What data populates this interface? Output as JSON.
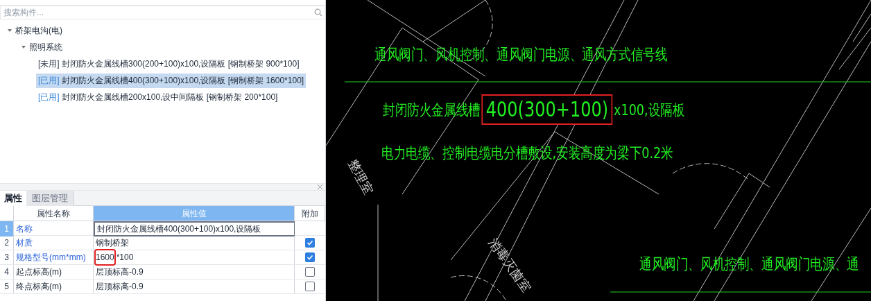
{
  "search": {
    "placeholder": "搜索构件..."
  },
  "tree": [
    {
      "label": "桥架电沟(电)",
      "expanded": true,
      "children": [
        {
          "label": "照明系统",
          "expanded": true,
          "children": [
            {
              "tag": "[未用]",
              "used": false,
              "label": "封闭防火金属线槽300(200+100)x100,设隔板 [钢制桥架 900*100]",
              "selected": false
            },
            {
              "tag": "[已用]",
              "used": true,
              "label": "封闭防火金属线槽400(300+100)x100,设隔板 [钢制桥架 1600*100]",
              "selected": true
            },
            {
              "tag": "[已用]",
              "used": true,
              "label": "封闭防火金属线槽200x100,设中间隔板 [钢制桥架 200*100]",
              "selected": false
            }
          ]
        }
      ]
    }
  ],
  "tabs": [
    {
      "label": "属性",
      "selected": true
    },
    {
      "label": "图层管理",
      "selected": false
    }
  ],
  "table": {
    "columns": [
      "属性名称",
      "属性值",
      "附加"
    ],
    "rows": [
      {
        "index": "1",
        "name": "名称",
        "linked": true,
        "value": [
          {
            "text": "封闭防火金属线槽400(300+100)x100,设隔板",
            "highlighted": false
          }
        ],
        "editing": true,
        "selected": true
      },
      {
        "index": "2",
        "name": "材质",
        "linked": true,
        "value": [
          {
            "text": "钢制桥架",
            "highlighted": false
          }
        ],
        "editing": false,
        "selected": false,
        "checked": true
      },
      {
        "index": "3",
        "name": "规格型号(mm*mm)",
        "linked": true,
        "value": [
          {
            "text": "1600",
            "highlighted": true
          },
          {
            "text": "*100",
            "highlighted": false
          }
        ],
        "editing": false,
        "selected": false,
        "checked": true
      },
      {
        "index": "4",
        "name": "起点标高(m)",
        "linked": false,
        "value": [
          {
            "text": "层顶标高-0.9",
            "highlighted": false
          }
        ],
        "editing": false,
        "selected": false,
        "checked": false
      },
      {
        "index": "5",
        "name": "终点标高(m)",
        "linked": false,
        "value": [
          {
            "text": "层顶标高-0.9",
            "highlighted": false
          }
        ],
        "editing": false,
        "selected": false,
        "checked": false
      }
    ]
  },
  "drawing": {
    "labels": [
      {
        "kind": "annotation",
        "parts": [
          {
            "text": "通风阀门、风机控制、通风阀门电源、通风方式信号线",
            "highlighted": false
          }
        ]
      },
      {
        "kind": "annotation",
        "parts": [
          {
            "text": "封闭防火金属线槽",
            "highlighted": false
          },
          {
            "text": "400(300+100)",
            "highlighted": true
          },
          {
            "text": "x100,设隔板",
            "highlighted": false
          }
        ]
      },
      {
        "kind": "annotation",
        "parts": [
          {
            "text": "电力电缆、控制电缆电分槽敷设,安装高度为梁下0.2米",
            "highlighted": false
          }
        ]
      },
      {
        "kind": "annotation",
        "parts": [
          {
            "text": "通风阀门、风机控制、通风阀门电源、通",
            "highlighted": false
          }
        ]
      },
      {
        "kind": "room",
        "parts": [
          {
            "text": "整理室",
            "highlighted": false
          }
        ]
      },
      {
        "kind": "room",
        "parts": [
          {
            "text": "消毒灭菌室",
            "highlighted": false
          }
        ]
      }
    ]
  }
}
